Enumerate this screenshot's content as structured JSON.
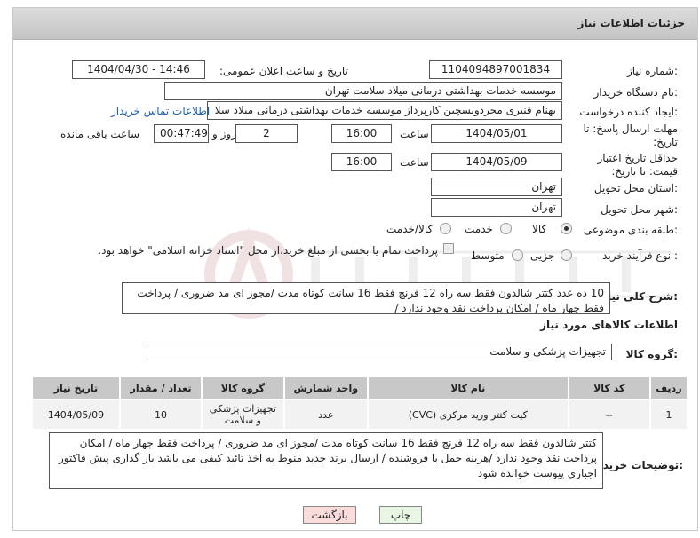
{
  "header": {
    "title": "جزئیات اطلاعات نیاز"
  },
  "fields": {
    "need_number_label": "شماره نیاز:",
    "need_number": "1104094897001834",
    "announce_label": "تاریخ و ساعت اعلان عمومی:",
    "announce_value": "1404/04/30 - 14:46",
    "buyer_org_label": "نام دستگاه خریدار:",
    "buyer_org": "موسسه خدمات بهداشتی درمانی میلاد سلامت تهران",
    "creator_label": "ایجاد کننده درخواست:",
    "creator": "بهنام قنبری مجردوبسچین کارپرداز موسسه خدمات بهداشتی درمانی میلاد سلا",
    "buyer_contact_link": "اطلاعات تماس خریدار",
    "reply_deadline_label": "مهلت ارسال پاسخ: تا تاریخ:",
    "reply_date": "1404/05/01",
    "time_label": "ساعت",
    "reply_time": "16:00",
    "days_value": "2",
    "days_label": "روز و",
    "remaining_time": "00:47:49",
    "remaining_label": "ساعت باقی مانده",
    "price_validity_label": "حداقل تاریخ اعتبار قیمت: تا تاریخ:",
    "validity_date": "1404/05/09",
    "validity_time": "16:00",
    "province_label": "استان محل تحویل:",
    "province": "تهران",
    "city_label": "شهر محل تحویل:",
    "city": "تهران",
    "category_label": "طبقه بندی موضوعی:",
    "category_options": [
      "کالا",
      "خدمت",
      "کالا/خدمت"
    ],
    "category_selected": "کالا",
    "process_label": "نوع فرآیند خرید :",
    "process_options": [
      "جزیی",
      "متوسط"
    ],
    "payment_note": "پرداخت تمام یا بخشی از مبلغ خرید،از محل \"اسناد خزانه اسلامی\" خواهد بود."
  },
  "description": {
    "label": "شرح کلی نیاز:",
    "text": "10 ده عدد کتتر شالدون   فقط سه راه 12 فرنچ  فقط 16 سانت کوتاه مدت  /مجوز ای مد ضروری / پرداخت  فقط چهار  ماه / امکان پرداخت نقد وجود ندارد  /"
  },
  "goods_info_title": "اطلاعات کالاهای مورد نیاز",
  "goods_group": {
    "label": "گروه کالا:",
    "value": "تجهیزات پزشکی و سلامت"
  },
  "table": {
    "headers": [
      "ردیف",
      "کد کالا",
      "نام کالا",
      "واحد شمارش",
      "گروه کالا",
      "تعداد / مقدار",
      "تاریخ نیاز"
    ],
    "rows": [
      [
        "1",
        "--",
        "کیت کتتر ورید مرکزی (CVC)",
        "عدد",
        "تجهیزات پزشکی و سلامت",
        "10",
        "1404/05/09"
      ]
    ]
  },
  "buyer_notes": {
    "label": "توضیحات خریدار:",
    "text": "کتتر شالدون   فقط سه راه 12 فرنچ  فقط 16 سانت کوتاه مدت /مجوز ای مد ضروری / پرداخت  فقط چهار  ماه / امکان پرداخت نقد  وجود ندارد  /هزینه حمل  با فروشنده / ارسال برند جدید منوط به اخذ تائید کیفی می باشد بار گذاری پیش فاکتور اجباری پیوست خوانده شود"
  },
  "buttons": {
    "print": "چاپ",
    "back": "بازگشت"
  },
  "colors": {
    "link": "#1a5fb4",
    "back_button_bg": "#fbdcdc",
    "print_button_bg": "#eaf6e4"
  }
}
